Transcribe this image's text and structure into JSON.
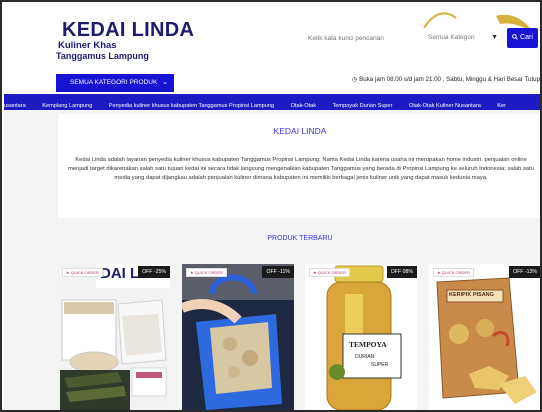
{
  "header": {
    "logo_title": "KEDAI LINDA",
    "logo_subtitle_1": "Kuliner Khas",
    "logo_subtitle_2": "Tanggamus Lampung",
    "search_placeholder": "Ketik kata kunci pencarian",
    "category_select": "Semua Kategori",
    "search_button": "Cari"
  },
  "nav": {
    "all_categories_button": "SEMUA KATEGORI PRODUK",
    "hours": "Buka jam 08.00 s/d jam 21.00 , Sabtu, Minggu & Hari Besar Tutup",
    "categories": [
      "usantara",
      "Kemplang Lampung",
      "Penyedia kuliner khusus kabupaten Tanggamus Propinsi Lampung",
      "Otak-Otak",
      "Tempoyak Durian Super",
      "Otak-Otak Kuliner Nusantara",
      "Ker"
    ]
  },
  "about": {
    "title": "KEDAI LINDA",
    "text": "Kedai Linda adalah layanan penyedia kuliner khusus kabupaten Tanggamus Propinsi Lampung. Nama Kedai Linda karena usaha ini merupakan home industri. penjualan online menjadi target dikarenakan salah satu tujuan kedai ini secara tidak langsung mengenalkan kabupaten Tanggamus yang berada di Propinsi Lampung ke seluruh Indonesia; salah satu media yang dapat dijangkau adalah penjualan kuliner dimana kabupaten ini memiliki berbagai jenis kuliner unik yang dapat masuk kedunia maya."
  },
  "products": {
    "title": "PRODUK TERBARU",
    "items": [
      {
        "quick_order": "QUICK ORDER",
        "discount": "OFF -25%",
        "image_text": "DAI LIN"
      },
      {
        "quick_order": "QUICK ORDER",
        "discount": "OFF -11%"
      },
      {
        "quick_order": "QUICK ORDER",
        "discount": "OFF 08%",
        "image_text_1": "TEMPOYA",
        "image_text_2": "DURIAN",
        "image_text_3": "SUPER"
      },
      {
        "quick_order": "QUICK ORDER",
        "discount": "OFF -13%",
        "image_text": "KERIPIK PISANG"
      }
    ]
  },
  "colors": {
    "brand_blue": "#1a13d6",
    "logo_navy": "#1e1b6e",
    "gold": "#c9a227"
  }
}
